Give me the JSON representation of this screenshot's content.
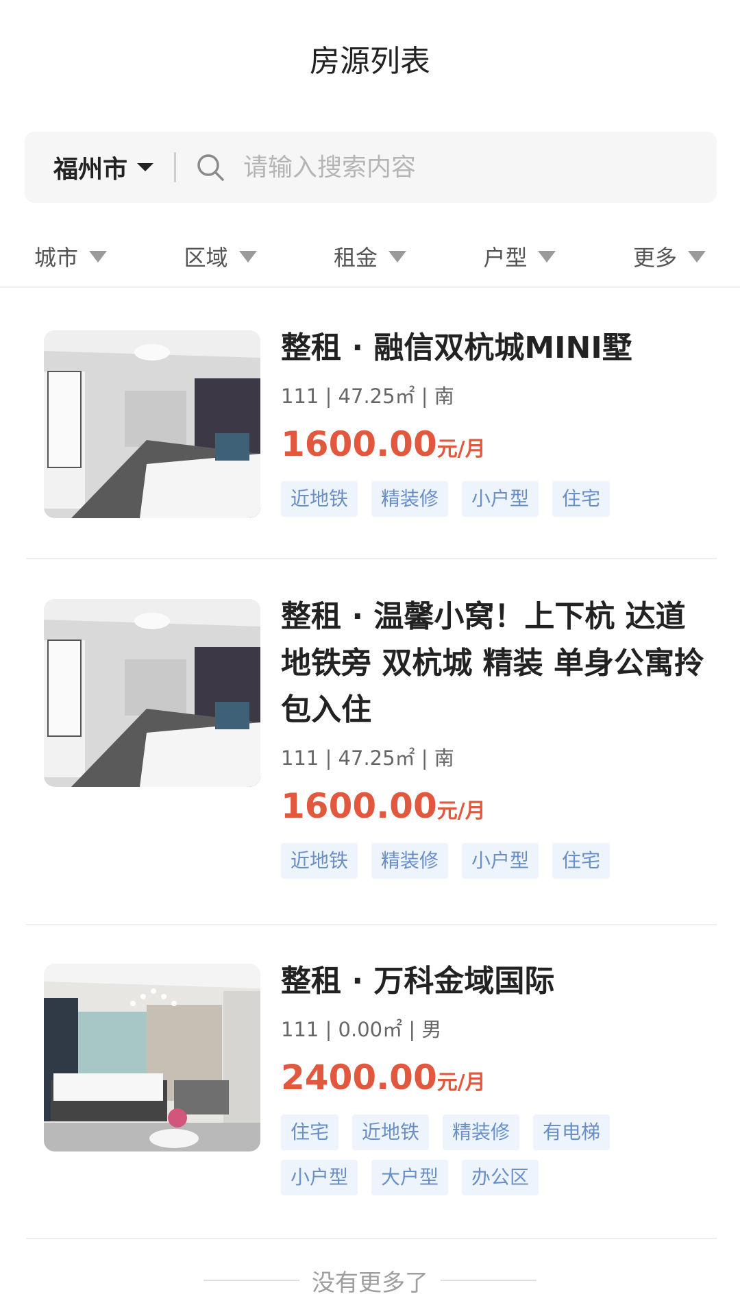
{
  "header": {
    "title": "房源列表"
  },
  "search": {
    "city": "福州市",
    "placeholder": "请输入搜索内容"
  },
  "filters": [
    {
      "label": "城市"
    },
    {
      "label": "区域"
    },
    {
      "label": "租金"
    },
    {
      "label": "户型"
    },
    {
      "label": "更多"
    }
  ],
  "listings": [
    {
      "title": "整租 · 融信双杭城MINI墅",
      "meta": "111 | 47.25㎡ | 南",
      "price": "1600.00",
      "unit": "元/月",
      "tags": [
        "近地铁",
        "精装修",
        "小户型",
        "住宅"
      ]
    },
    {
      "title": "整租 · 温馨小窝！上下杭 达道地铁旁 双杭城 精装 单身公寓拎包入住",
      "meta": "111 | 47.25㎡ | 南",
      "price": "1600.00",
      "unit": "元/月",
      "tags": [
        "近地铁",
        "精装修",
        "小户型",
        "住宅"
      ]
    },
    {
      "title": "整租 · 万科金域国际",
      "meta": "111 | 0.00㎡ | 男",
      "price": "2400.00",
      "unit": "元/月",
      "tags": [
        "住宅",
        "近地铁",
        "精装修",
        "有电梯",
        "小户型",
        "大户型",
        "办公区"
      ]
    }
  ],
  "footer": {
    "end_text": "没有更多了"
  }
}
